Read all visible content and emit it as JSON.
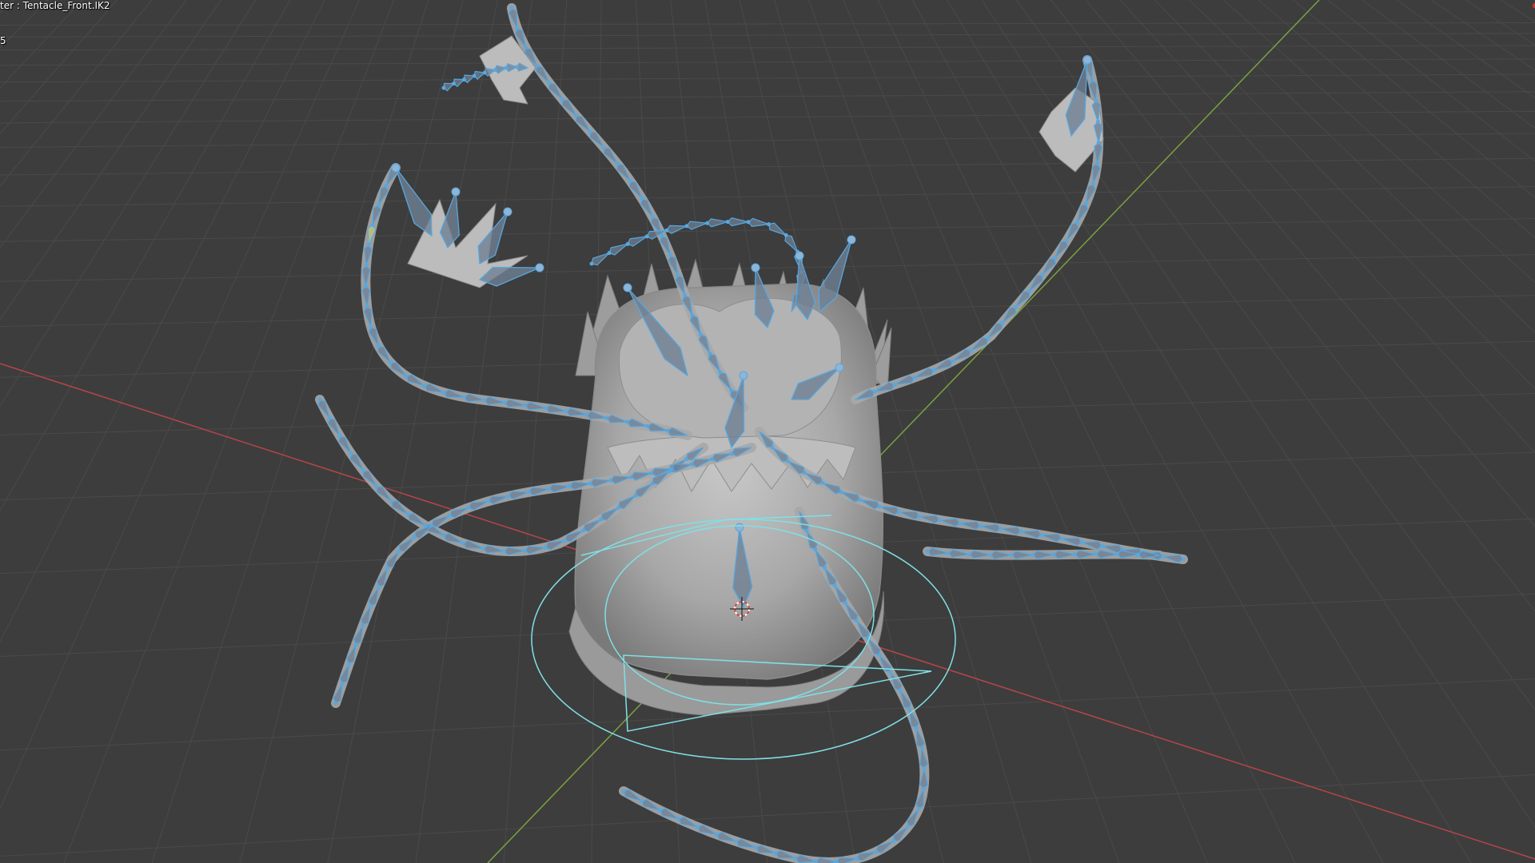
{
  "viewport": {
    "overlay_title": "ter : Tentacle_Front.IK2",
    "overlay_sub": "5"
  },
  "colors": {
    "background": "#3d3d3d",
    "grid": "#4a4a4a",
    "x_axis": "#b8454a",
    "y_axis": "#7ba13f",
    "bone": "#56a8e0",
    "bone_fill": "#6f7f93",
    "bone_active": "#c4c27a",
    "mesh": "#a9a9a9",
    "control_circle": "#7fe0e6"
  },
  "icons": {
    "origin": "3d-cursor-icon"
  }
}
